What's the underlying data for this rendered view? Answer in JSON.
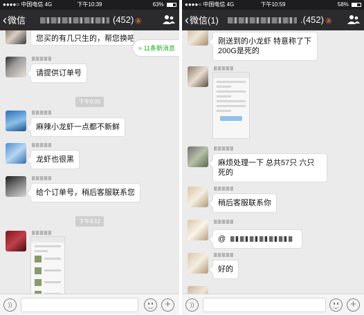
{
  "left": {
    "status": {
      "carrier": "●●●●○ 中国电信  4G",
      "time": "下午10:39",
      "battery": "63%",
      "battery_level": 0.63
    },
    "nav": {
      "back_label": "微信",
      "member_count": "(452)"
    },
    "new_messages": "11条新消息",
    "messages": {
      "m1": "您买的有几只生的，帮您换吧",
      "m2": "请提供订单号",
      "m3": "麻辣小龙虾一点都不新鲜",
      "m4": "龙虾也很黑",
      "m5": "给个订单号，稍后客服联系您"
    },
    "times": {
      "t1": "下午9:05",
      "t2": "下午9:12"
    }
  },
  "right": {
    "status": {
      "carrier": "●●●●○ 中国电信  4G",
      "time": "下午10:59",
      "battery": "58%",
      "battery_level": 0.58
    },
    "nav": {
      "back_label": "微信(1)",
      "member_count": ".(452)"
    },
    "messages": {
      "m1": "刚送到的小龙虾 特意称了下200G是死的",
      "m2": "麻烦处理一下 总共57只 六只死的",
      "m3": "稍后客服联系你",
      "m4": "@",
      "m5": "好的"
    }
  },
  "icons": {
    "back": "chevron-left-icon",
    "group": "group-members-icon",
    "voice": "voice-icon",
    "emoji": "emoji-icon",
    "plus": "plus-icon",
    "new_messages": "double-chevron-up-icon"
  },
  "colors": {
    "nav_bg": "#2b2b2d",
    "chat_bg": "#ebebeb",
    "accent_green": "#1aad19"
  }
}
